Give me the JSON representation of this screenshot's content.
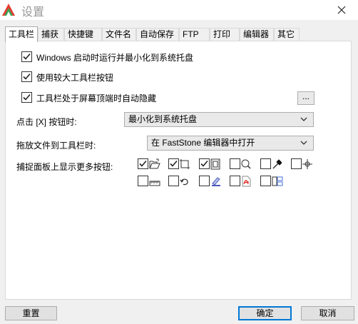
{
  "window": {
    "title": "设置"
  },
  "tabs": [
    "工具栏",
    "捕获",
    "快捷键",
    "文件名",
    "自动保存",
    "FTP",
    "打印",
    "编辑器",
    "其它"
  ],
  "options": [
    {
      "label": "Windows 启动时运行并最小化到系统托盘",
      "checked": true
    },
    {
      "label": "使用较大工具栏按钮",
      "checked": true
    },
    {
      "label": "工具栏处于屏幕顶端时自动隐藏",
      "checked": true
    }
  ],
  "more_button": {
    "label": "..."
  },
  "click_x": {
    "label": "点击 [X] 按钮时:",
    "value": "最小化到系统托盘"
  },
  "drag_files": {
    "label": "拖放文件到工具栏时:",
    "value": "在 FastStone 编辑器中打开"
  },
  "capture_panel": {
    "label": "捕捉面板上显示更多按钮:",
    "buttons": [
      {
        "icon": "open-folder-icon",
        "checked": true
      },
      {
        "icon": "rectangle-region-icon",
        "checked": true
      },
      {
        "icon": "film-strip-icon",
        "checked": true
      },
      {
        "icon": "magnifier-icon",
        "checked": false
      },
      {
        "icon": "color-picker-icon",
        "checked": false
      },
      {
        "icon": "crosshair-icon",
        "checked": false
      },
      {
        "icon": "ruler-icon",
        "checked": false
      },
      {
        "icon": "undo-arrow-icon",
        "checked": false
      },
      {
        "icon": "draw-icon",
        "checked": false
      },
      {
        "icon": "pdf-icon",
        "checked": false
      },
      {
        "icon": "screen-compare-icon",
        "checked": false
      }
    ]
  },
  "footer": {
    "reset": "重置",
    "ok": "确定",
    "cancel": "取消"
  },
  "colors": {
    "title_text": "#9a9a9a",
    "accent_border": "#0078d7",
    "panel_bg": "#ffffff",
    "window_bg": "#f0f0f0"
  }
}
